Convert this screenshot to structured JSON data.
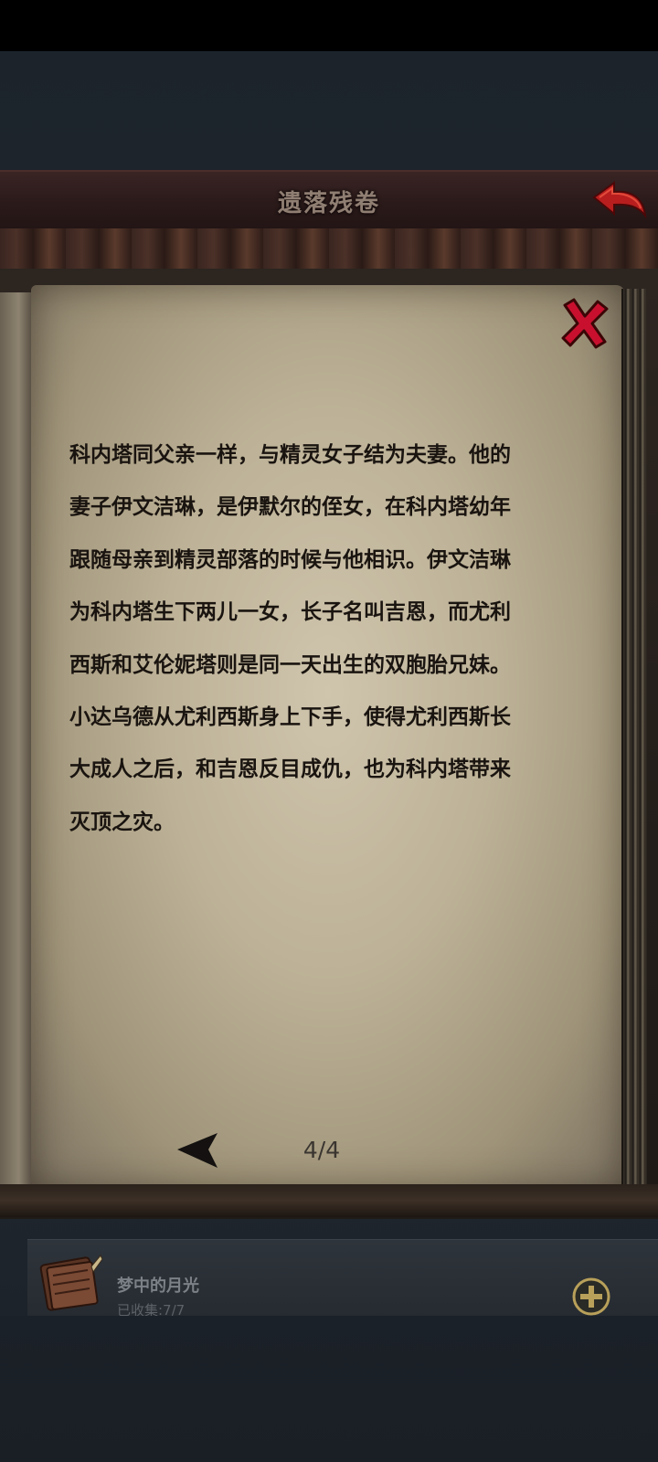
{
  "header": {
    "title": "遗落残卷",
    "back_icon": "back-arrow-icon"
  },
  "scroll": {
    "close_icon": "close-x-icon",
    "lines": [
      "科内塔同父亲一样，与精灵女子结为夫妻。他的",
      "妻子伊文洁琳，是伊默尔的侄女，在科内塔幼年",
      "跟随母亲到精灵部落的时候与他相识。伊文洁琳",
      "为科内塔生下两儿一女，长子名叫吉恩，而尤利",
      "西斯和艾伦妮塔则是同一天出生的双胞胎兄妹。",
      "小达乌德从尤利西斯身上下手，使得尤利西斯长",
      "大成人之后，和吉恩反目成仇，也为科内塔带来",
      "灭顶之灾。"
    ],
    "page_indicator": "4/4",
    "prev_icon": "prev-page-arrow-icon"
  },
  "collection": {
    "name": "梦中的月光",
    "count_text": "已收集:7/7",
    "icon": "book-icon",
    "add_icon": "plus-circle-icon"
  },
  "colors": {
    "title_bar": "#2b1a1a",
    "parchment": "#bdb297",
    "close_red": "#c8102e",
    "accent_gold": "#b8a05a"
  }
}
